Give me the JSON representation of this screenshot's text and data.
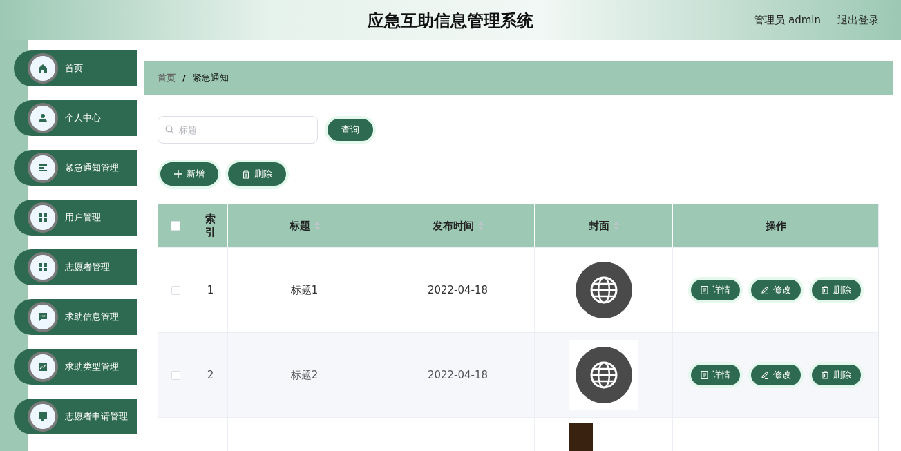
{
  "header": {
    "title": "应急互助信息管理系统",
    "user": "管理员 admin",
    "logout": "退出登录"
  },
  "sidebar": {
    "items": [
      {
        "label": "首页"
      },
      {
        "label": "个人中心"
      },
      {
        "label": "紧急通知管理"
      },
      {
        "label": "用户管理"
      },
      {
        "label": "志愿者管理"
      },
      {
        "label": "求助信息管理"
      },
      {
        "label": "求助类型管理"
      },
      {
        "label": "志愿者申请管理"
      }
    ]
  },
  "breadcrumb": [
    {
      "label": "首页"
    },
    {
      "label": "紧急通知"
    }
  ],
  "breadcrumb_separator": "/",
  "search": {
    "placeholder": "标题",
    "button": "查询"
  },
  "actions": [
    {
      "kind": "add",
      "label": "新增"
    },
    {
      "kind": "delete",
      "label": "删除"
    }
  ],
  "table": {
    "all_checked": false,
    "columns": [
      {
        "label": "索引",
        "sortable": false
      },
      {
        "label": "标题",
        "sortable": true
      },
      {
        "label": "发布时间",
        "sortable": true
      },
      {
        "label": "封面",
        "sortable": true
      },
      {
        "label": "操作",
        "sortable": false
      }
    ],
    "rows": [
      {
        "checked": false,
        "index": "1",
        "title": "标题1",
        "date": "2022-04-18",
        "cover": {
          "kind": "globe",
          "framed": false
        },
        "buttons": [
          {
            "kind": "detail",
            "label": "详情"
          },
          {
            "kind": "edit",
            "label": "修改"
          },
          {
            "kind": "delete",
            "label": "删除"
          }
        ]
      },
      {
        "checked": false,
        "index": "2",
        "title": "标题2",
        "date": "2022-04-18",
        "cover": {
          "kind": "globe",
          "framed": true
        },
        "buttons": [
          {
            "kind": "detail",
            "label": "详情"
          },
          {
            "kind": "edit",
            "label": "修改"
          },
          {
            "kind": "delete",
            "label": "删除"
          }
        ]
      },
      {
        "cover": {
          "kind": "photo"
        }
      }
    ]
  }
}
